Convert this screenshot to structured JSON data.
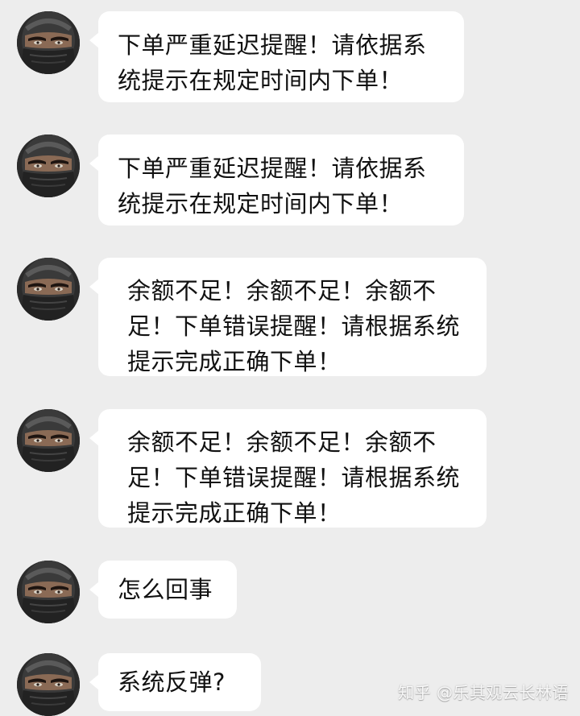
{
  "messages": [
    {
      "text": "下单严重延迟提醒！请依据系统提示在规定时间内下单！"
    },
    {
      "text": "下单严重延迟提醒！请依据系统提示在规定时间内下单！"
    },
    {
      "text": "余额不足！余额不足！余额不足！下单错误提醒！请根据系统提示完成正确下单！"
    },
    {
      "text": "余额不足！余额不足！余额不足！下单错误提醒！请根据系统提示完成正确下单！"
    },
    {
      "text": "怎么回事"
    },
    {
      "text": "系统反弹?"
    }
  ],
  "watermark": "知乎 @乐其观云长林语",
  "colors": {
    "background": "#ededed",
    "bubble": "#ffffff",
    "text": "#111111"
  },
  "icons": {
    "avatar": "masked-ninja-avatar"
  }
}
